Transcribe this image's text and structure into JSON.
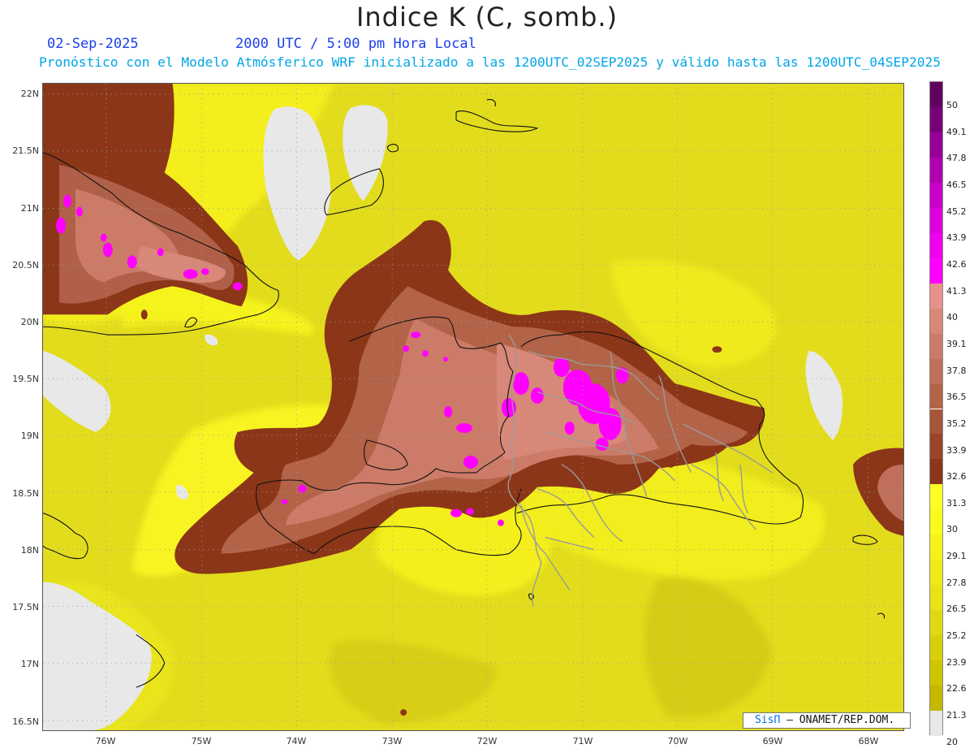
{
  "title": "Indice K (C, somb.)",
  "date": "02-Sep-2025",
  "time": "2000 UTC / 5:00 pm Hora Local",
  "subtitle": "Pronóstico con el Modelo Atmósferico WRF inicializado a las 1200UTC_02SEP2025 y válido hasta las  1200UTC_04SEP2025",
  "lat_labels": [
    "22N",
    "21.5N",
    "21N",
    "20.5N",
    "20N",
    "19.5N",
    "19N",
    "18.5N",
    "18N",
    "17.5N",
    "17N",
    "16.5N"
  ],
  "lon_labels": [
    "76W",
    "75W",
    "74W",
    "73W",
    "72W",
    "71W",
    "70W",
    "69W",
    "68W"
  ],
  "colorbar": {
    "labels": [
      "50",
      "49.1",
      "47.8",
      "46.5",
      "45.2",
      "43.9",
      "42.6",
      "41.3",
      "40",
      "39.1",
      "37.8",
      "36.5",
      "35.2",
      "33.9",
      "32.6",
      "31.3",
      "30",
      "29.1",
      "27.8",
      "26.5",
      "25.2",
      "23.9",
      "22.6",
      "21.3",
      "20"
    ],
    "colors": [
      "#e8e8e8",
      "#c4b800",
      "#cfc400",
      "#d8cf08",
      "#e0d810",
      "#e8e218",
      "#efeb18",
      "#f5f218",
      "#fafa1c",
      "#fffd26",
      "#8b3618",
      "#9a4528",
      "#a65538",
      "#b36348",
      "#c06f5a",
      "#cc7b68",
      "#d88878",
      "#e8908a",
      "#ff00ff",
      "#f000f0",
      "#dd00dd",
      "#c800c8",
      "#b000b0",
      "#960096",
      "#780078",
      "#60005f"
    ]
  },
  "credit": {
    "brand": "SisΠ",
    "rest": "– ONAMET/REP.DOM."
  }
}
